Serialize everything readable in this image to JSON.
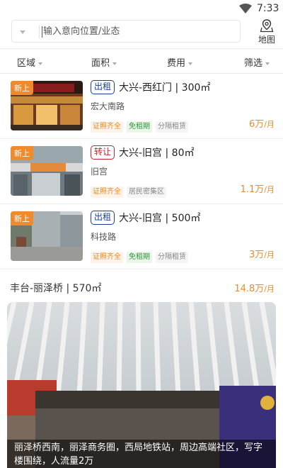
{
  "status_bar": {
    "time": "7:33"
  },
  "search": {
    "placeholder": "输入意向位置/业态",
    "map_label": "地图"
  },
  "filters": [
    "区域",
    "面积",
    "费用",
    "筛选"
  ],
  "listings": [
    {
      "badge": "新上",
      "type": "出租",
      "title": "大兴-西红门 | 300㎡",
      "road": "宏大南路",
      "tags": [
        "证照齐全",
        "免租期",
        "分隔租赁"
      ],
      "price": "6万",
      "price_unit": "/月"
    },
    {
      "badge": "新上",
      "type": "转让",
      "title": "大兴-旧宫 | 80㎡",
      "road": "旧宫",
      "tags": [
        "证照齐全",
        "居民密集区"
      ],
      "price": "1.1万",
      "price_unit": "/月"
    },
    {
      "badge": "新上",
      "type": "出租",
      "title": "大兴-旧宫 | 500㎡",
      "road": "科技路",
      "tags": [
        "证照齐全",
        "免租期",
        "分隔租赁"
      ],
      "price": "3万",
      "price_unit": "/月"
    }
  ],
  "featured": {
    "title": "丰台-丽泽桥 | 570㎡",
    "price": "14.8万",
    "price_unit": "/月",
    "caption": "丽泽桥西南，丽泽商务圈，西局地铁站，周边高端社区，写字楼围绕，人流量2万"
  },
  "colors": {
    "accent_orange": "#e58c2c",
    "rent_blue": "#1d3c96",
    "transfer_red": "#c0242c",
    "free_green": "#2a9a3a"
  }
}
